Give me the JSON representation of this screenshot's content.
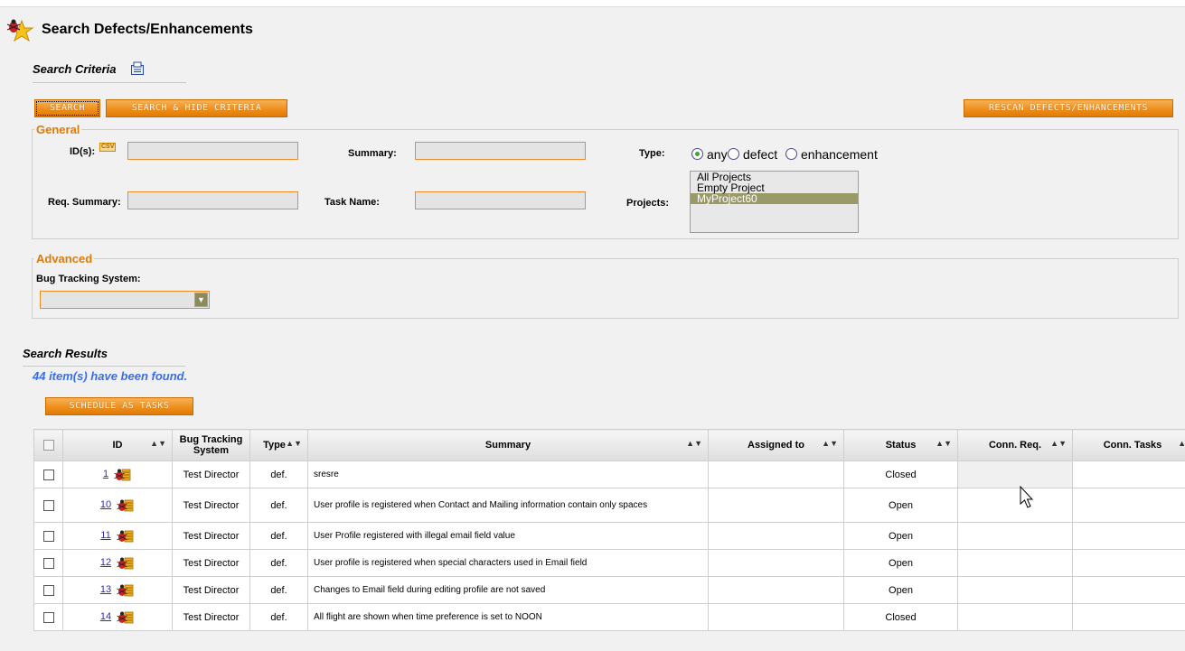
{
  "page_title": "Search Defects/Enhancements",
  "criteria": {
    "title": "Search Criteria",
    "buttons": {
      "search": "SEARCH",
      "search_hide": "SEARCH & HIDE CRITERIA",
      "rescan": "RESCAN DEFECTS/ENHANCEMENTS"
    },
    "general": {
      "legend": "General",
      "ids_label": "ID(s):",
      "csv_badge": "CSV",
      "summary_label": "Summary:",
      "type_label": "Type:",
      "type_options": [
        "any",
        "defect",
        "enhancement"
      ],
      "type_selected": "any",
      "req_summary_label": "Req. Summary:",
      "task_name_label": "Task Name:",
      "projects_label": "Projects:",
      "projects": [
        "All Projects",
        "Empty Project",
        "MyProject60"
      ],
      "project_selected": "MyProject60"
    },
    "advanced": {
      "legend": "Advanced",
      "bts_label": "Bug Tracking System:",
      "bts_value": ""
    }
  },
  "results": {
    "title": "Search Results",
    "found_text": "44 item(s) have been found.",
    "schedule_button": "SCHEDULE AS TASKS",
    "columns": [
      "ID",
      "Bug Tracking System",
      "Type",
      "Summary",
      "Assigned to",
      "Status",
      "Conn. Req.",
      "Conn. Tasks"
    ],
    "rows": [
      {
        "id": "1",
        "bts": "Test Director",
        "type": "def.",
        "summary": "sresre",
        "assigned": "",
        "status": "Closed",
        "req": "",
        "tasks": ""
      },
      {
        "id": "10",
        "bts": "Test Director",
        "type": "def.",
        "summary": "User profile is registered when Contact and Mailing information contain only spaces",
        "assigned": "",
        "status": "Open",
        "req": "",
        "tasks": ""
      },
      {
        "id": "11",
        "bts": "Test Director",
        "type": "def.",
        "summary": "User Profile registered with illegal email field value",
        "assigned": "",
        "status": "Open",
        "req": "",
        "tasks": ""
      },
      {
        "id": "12",
        "bts": "Test Director",
        "type": "def.",
        "summary": "User profile is registered when special characters used in Email field",
        "assigned": "",
        "status": "Open",
        "req": "",
        "tasks": ""
      },
      {
        "id": "13",
        "bts": "Test Director",
        "type": "def.",
        "summary": "Changes to Email field during editing profile are not saved",
        "assigned": "",
        "status": "Open",
        "req": "",
        "tasks": ""
      },
      {
        "id": "14",
        "bts": "Test Director",
        "type": "def.",
        "summary": "All flight are shown when time preference is set to NOON",
        "assigned": "",
        "status": "Closed",
        "req": "",
        "tasks": ""
      }
    ]
  },
  "icons": {
    "page": "bug-star-icon",
    "export": "export-icon",
    "row": "bug-icon",
    "dropdown": "chevron-down-icon",
    "sort": "sort-arrows-icon",
    "cursor": "mouse-cursor-icon"
  },
  "colors": {
    "accent_orange": "#ef8f1c",
    "link_blue": "#2a2ad0",
    "found_blue": "#3a6ee8",
    "selected_option": "#9a9a68"
  }
}
